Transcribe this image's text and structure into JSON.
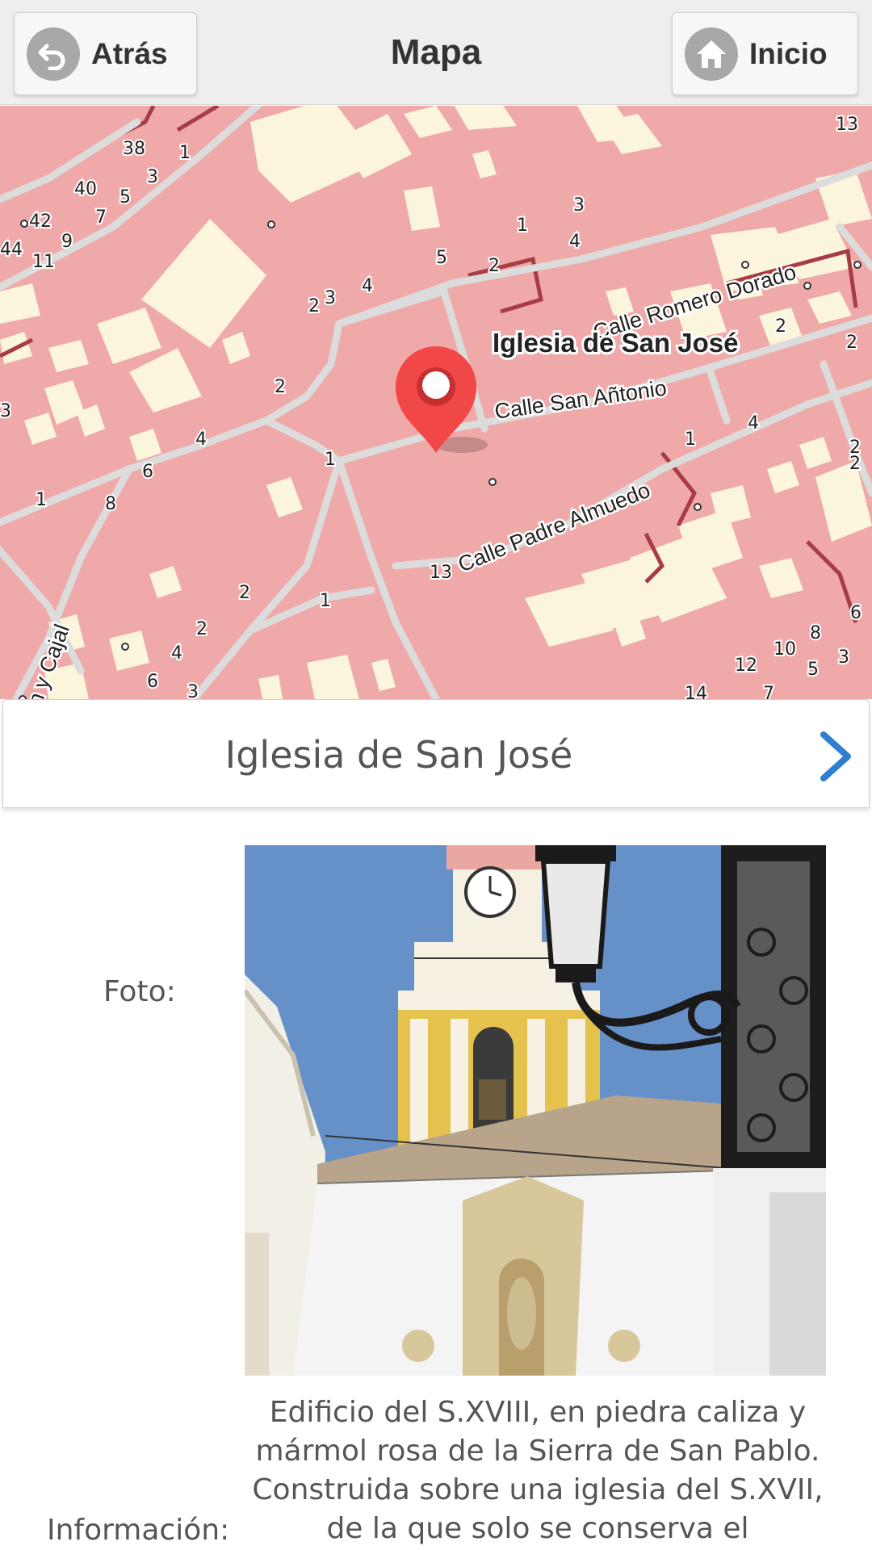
{
  "header": {
    "back_label": "Atrás",
    "title": "Mapa",
    "home_label": "Inicio"
  },
  "map": {
    "poi_label": "Iglesia de San José",
    "streets": {
      "romero_dorado": "Calle Romero Dorado",
      "san_antonio": "Calle San Añtonio",
      "padre_almuedo": "Calle Padre Almuedo",
      "ramon_cajal": "e Ramon y Cajal"
    },
    "house_numbers": [
      "13",
      "38",
      "3",
      "1",
      "40",
      "5",
      "7",
      "42",
      "9",
      "44",
      "11",
      "3",
      "1",
      "4",
      "5",
      "2",
      "2",
      "3",
      "4",
      "2",
      "2",
      "2",
      "3",
      "4",
      "1",
      "6",
      "4",
      "8",
      "1",
      "13",
      "1",
      "2",
      "1",
      "2",
      "4",
      "6",
      "3",
      "14",
      "7",
      "12",
      "10",
      "8",
      "5",
      "3",
      "6",
      "2",
      "2"
    ]
  },
  "poi": {
    "title": "Iglesia de San José",
    "photo_label": "Foto:",
    "info_label": "Información:",
    "info_text": "Edificio del S.XVIII, en piedra caliza y mármol rosa de la Sierra de San Pablo. Construida sobre una iglesia del S.XVII, de la que solo se conserva el"
  },
  "colors": {
    "header_bg": "#eeeeee",
    "map_bg": "#efa9a8",
    "building": "#fbf5dc",
    "road": "#dcdcdc",
    "marker": "#f24747",
    "chevron": "#2f7fd0"
  },
  "icons": {
    "back": "back-arrow-icon",
    "home": "home-icon",
    "marker": "map-pin-icon",
    "next": "chevron-right-icon"
  }
}
